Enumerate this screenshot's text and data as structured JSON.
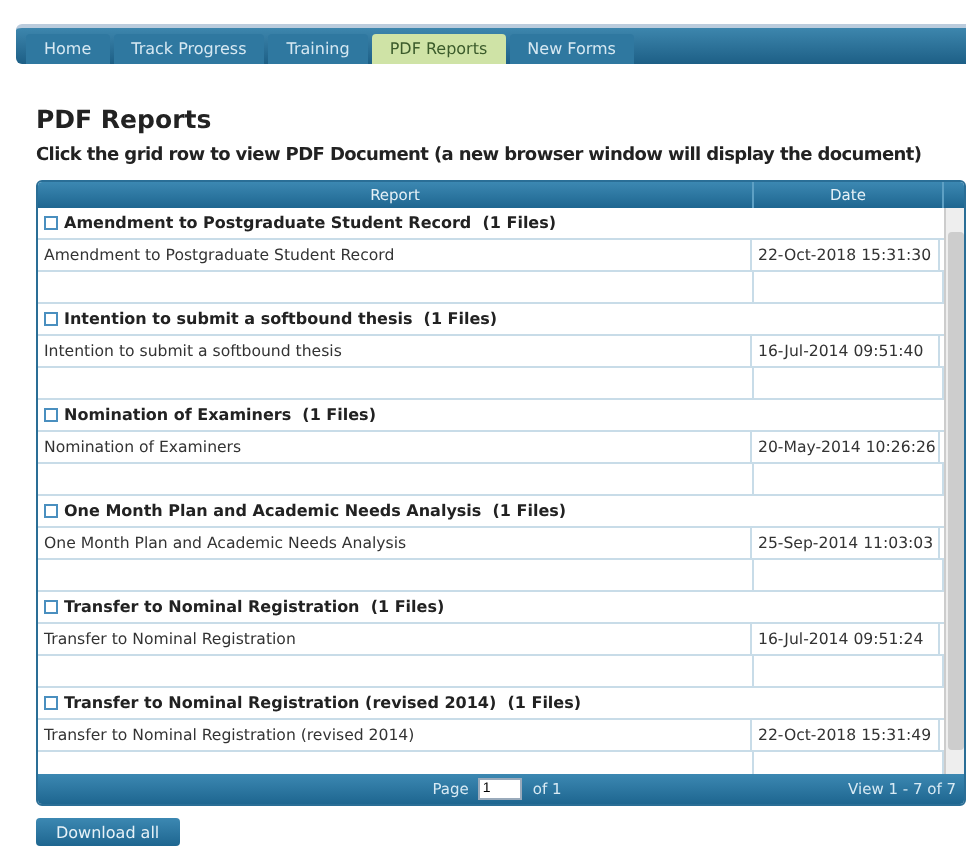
{
  "tabs": [
    {
      "label": "Home",
      "selected": false
    },
    {
      "label": "Track Progress",
      "selected": false
    },
    {
      "label": "Training",
      "selected": false
    },
    {
      "label": "PDF Reports",
      "selected": true
    },
    {
      "label": "New Forms",
      "selected": false
    }
  ],
  "heading": "PDF Reports",
  "instruction": "Click the grid row to view PDF Document (a new browser window will display the document)",
  "grid": {
    "columns": [
      "Report",
      "Date"
    ],
    "groups": [
      {
        "title": "Amendment to Postgraduate Student Record  (1 Files)",
        "expanded": true,
        "rows": [
          {
            "report": "Amendment to Postgraduate Student Record",
            "date": "22-Oct-2018 15:31:30"
          }
        ]
      },
      {
        "title": "Intention to submit a softbound thesis  (1 Files)",
        "expanded": true,
        "rows": [
          {
            "report": "Intention to submit a softbound thesis",
            "date": "16-Jul-2014 09:51:40"
          }
        ]
      },
      {
        "title": "Nomination of Examiners  (1 Files)",
        "expanded": true,
        "rows": [
          {
            "report": "Nomination of Examiners",
            "date": "20-May-2014 10:26:26"
          }
        ]
      },
      {
        "title": "One Month Plan and Academic Needs Analysis  (1 Files)",
        "expanded": true,
        "rows": [
          {
            "report": "One Month Plan and Academic Needs Analysis",
            "date": "25-Sep-2014 11:03:03"
          }
        ]
      },
      {
        "title": "Transfer to Nominal Registration  (1 Files)",
        "expanded": true,
        "rows": [
          {
            "report": "Transfer to Nominal Registration",
            "date": "16-Jul-2014 09:51:24"
          }
        ]
      },
      {
        "title": "Transfer to Nominal Registration (revised 2014)  (1 Files)",
        "expanded": true,
        "rows": [
          {
            "report": "Transfer to Nominal Registration (revised 2014)",
            "date": "22-Oct-2018 15:31:49"
          }
        ]
      }
    ],
    "pager": {
      "page_label": "Page",
      "page_value": "1",
      "of_label": "of 1",
      "view_label": "View 1 - 7 of 7"
    }
  },
  "download_button": "Download all"
}
